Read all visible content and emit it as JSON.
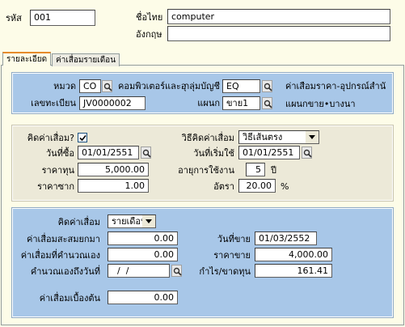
{
  "header": {
    "code_label": "รหัส",
    "code_value": "001",
    "name_th_label": "ชื่อไทย",
    "name_th_value": "computer",
    "name_en_label": "อังกฤษ",
    "name_en_value": ""
  },
  "tabs": [
    {
      "label": "รายละเอียด",
      "active": true
    },
    {
      "label": "ค่าเสื่อมรายเดือน",
      "active": false
    }
  ],
  "group": {
    "category_label": "หมวด",
    "category_code": "CO",
    "category_name": "คอมพิวเตอร์และอุ",
    "account_group_label": "กลุ่มบัญชี",
    "account_group_code": "EQ",
    "account_group_name": "ค่าเสื่อมราคา-อุปกรณ์สำนั",
    "register_label": "เลขทะเบียน",
    "register_value": "JV0000002",
    "department_label": "แผนก",
    "department_code": "ขาย1",
    "department_name": "แผนกขาย•บางนา"
  },
  "depreciation": {
    "calc_label": "คิดค่าเสื่อม?",
    "calc_checked": true,
    "method_label": "วิธีคิดค่าเสื่อม",
    "method_value": "วิธีเส้นตรง",
    "purchase_date_label": "วันที่ซื้อ",
    "purchase_date_value": "01/01/2551",
    "start_date_label": "วันที่เริ่มใช้",
    "start_date_value": "01/01/2551",
    "cost_label": "ราคาทุน",
    "cost_value": "5,000.00",
    "life_label": "อายุการใช้งาน",
    "life_value": "5",
    "life_unit": "ปี",
    "salvage_label": "ราคาซาก",
    "salvage_value": "1.00",
    "rate_label": "อัตรา",
    "rate_value": "20.00",
    "rate_unit": "%"
  },
  "summary": {
    "period_label": "คิดค่าเสื่อม",
    "period_value": "รายเดือน",
    "accum_label": "ค่าเสื่อมสะสมยกมา",
    "accum_value": "0.00",
    "manual_label": "ค่าเสื่อมที่คำนวณเอง",
    "manual_value": "0.00",
    "calc_until_label": "คำนวณเองถึงวันที่",
    "calc_until_value": "  /  /",
    "sale_date_label": "วันที่ขาย",
    "sale_date_value": "01/03/2552",
    "sale_price_label": "ราคาขาย",
    "sale_price_value": "4,000.00",
    "profit_label": "กำไร/ขาดทุน",
    "profit_value": "161.41",
    "initial_label": "ค่าเสื่อมเบื้องต้น",
    "initial_value": "0.00"
  }
}
